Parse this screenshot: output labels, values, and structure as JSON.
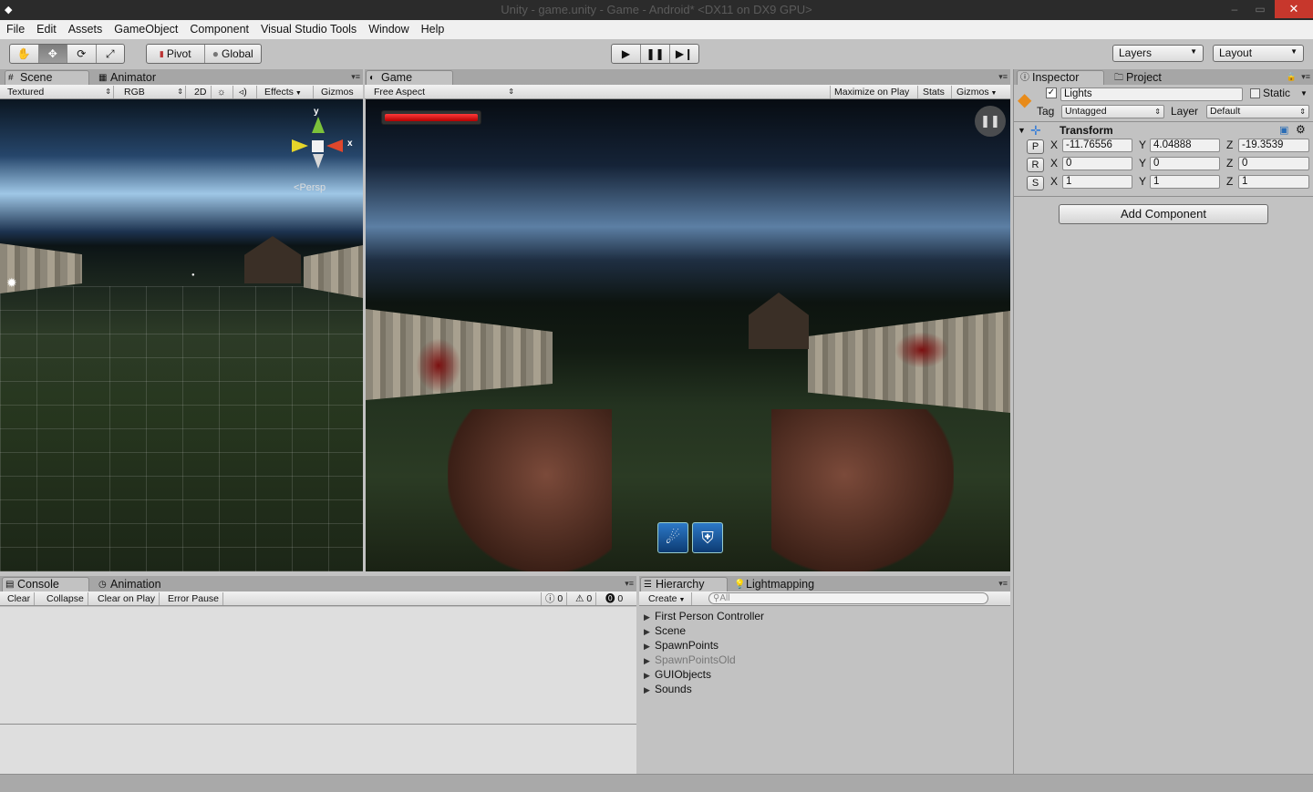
{
  "window": {
    "title": "Unity - game.unity - Game - Android* <DX11 on DX9 GPU>",
    "minimize": "‒",
    "maximize": "▭",
    "close": "✕"
  },
  "menu": [
    "File",
    "Edit",
    "Assets",
    "GameObject",
    "Component",
    "Visual Studio Tools",
    "Window",
    "Help"
  ],
  "toolbar": {
    "pivot": "Pivot",
    "global": "Global",
    "layers": "Layers",
    "layout": "Layout"
  },
  "scene_panel": {
    "tabs": [
      "Scene",
      "Animator"
    ],
    "draw_mode": "Textured",
    "render_mode": "RGB",
    "btn_2d": "2D",
    "effects": "Effects",
    "gizmos": "Gizmos",
    "persp": "Persp",
    "axis_y": "y",
    "axis_x": "x"
  },
  "game_panel": {
    "tab": "Game",
    "aspect": "Free Aspect",
    "maximize": "Maximize on Play",
    "stats": "Stats",
    "gizmos": "Gizmos",
    "health_fraction": 1.0
  },
  "inspector": {
    "tabs": [
      "Inspector",
      "Project"
    ],
    "object_name": "Lights",
    "active": true,
    "static_label": "Static",
    "tag_label": "Tag",
    "tag_value": "Untagged",
    "layer_label": "Layer",
    "layer_value": "Default",
    "component": "Transform",
    "position": {
      "btn": "P",
      "x": "-11.76556",
      "y": "4.04888",
      "z": "-19.3539"
    },
    "rotation": {
      "btn": "R",
      "x": "0",
      "y": "0",
      "z": "0"
    },
    "scale": {
      "btn": "S",
      "x": "1",
      "y": "1",
      "z": "1"
    },
    "axis_x": "X",
    "axis_y": "Y",
    "axis_z": "Z",
    "add_component": "Add Component"
  },
  "console_panel": {
    "tabs": [
      "Console",
      "Animation"
    ],
    "clear": "Clear",
    "collapse": "Collapse",
    "clear_on_play": "Clear on Play",
    "error_pause": "Error Pause",
    "log_count": "0",
    "warn_count": "0",
    "error_count": "0"
  },
  "hierarchy_panel": {
    "tabs": [
      "Hierarchy",
      "Lightmapping"
    ],
    "create": "Create",
    "search_placeholder": "All",
    "items": [
      {
        "label": "First Person Controller",
        "disabled": false
      },
      {
        "label": "Scene",
        "disabled": false
      },
      {
        "label": "SpawnPoints",
        "disabled": false
      },
      {
        "label": "SpawnPointsOld",
        "disabled": true
      },
      {
        "label": "GUIObjects",
        "disabled": false
      },
      {
        "label": "Sounds",
        "disabled": false
      }
    ]
  }
}
